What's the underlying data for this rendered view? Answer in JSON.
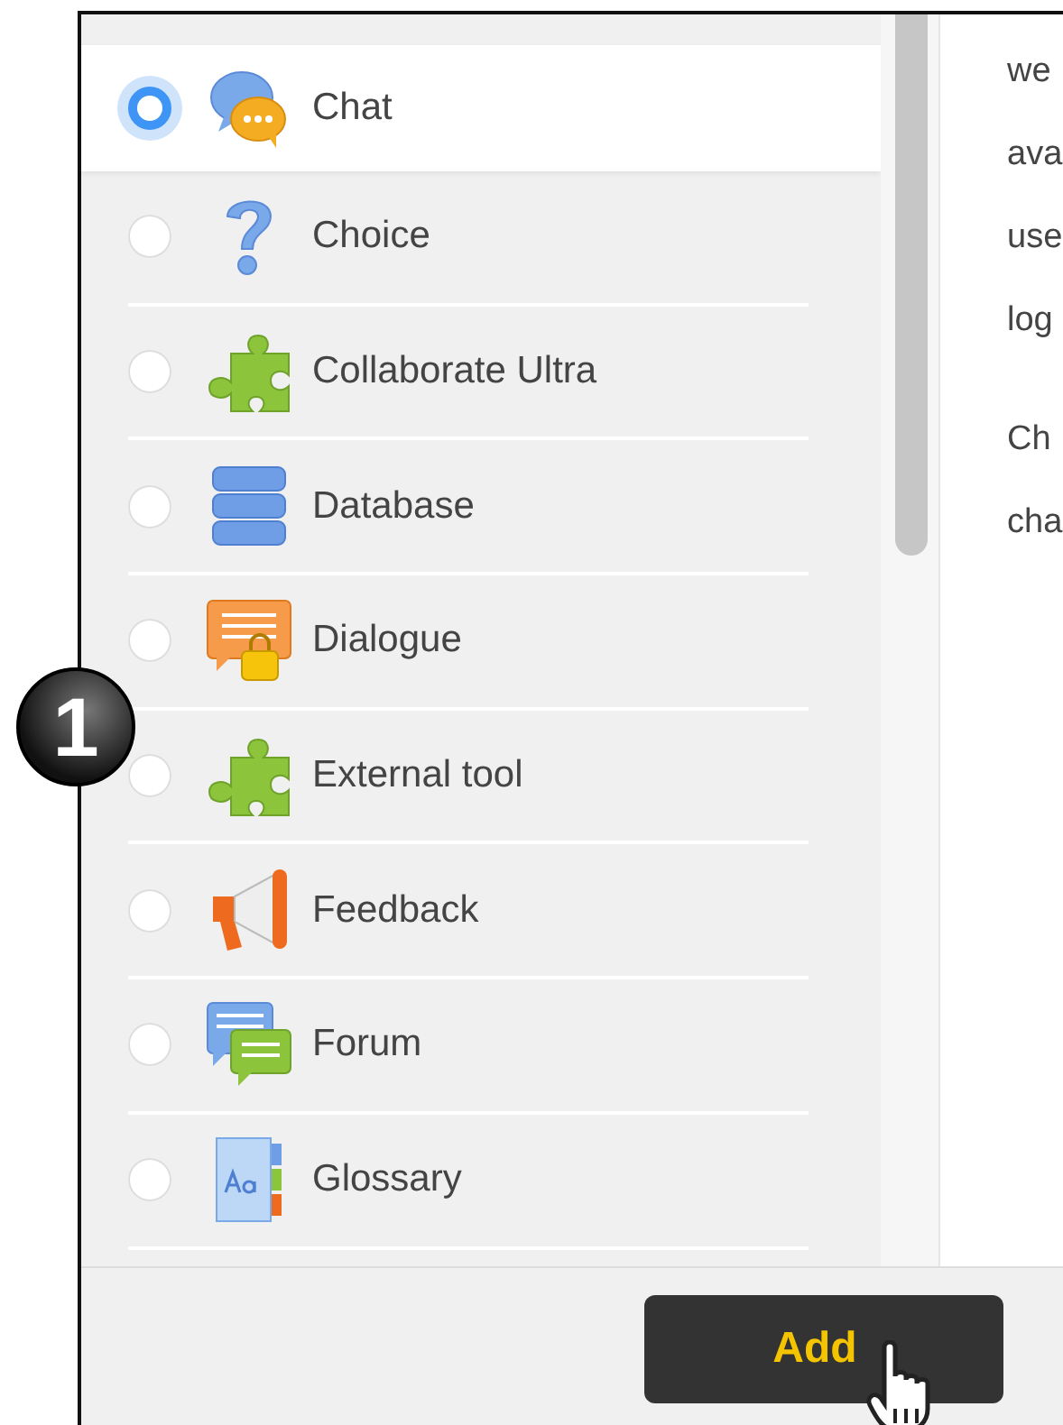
{
  "activities": [
    {
      "label": "Chat",
      "kind": "chat",
      "selected": true
    },
    {
      "label": "Choice",
      "kind": "question",
      "selected": false
    },
    {
      "label": "Collaborate Ultra",
      "kind": "puzzle",
      "selected": false
    },
    {
      "label": "Database",
      "kind": "database",
      "selected": false
    },
    {
      "label": "Dialogue",
      "kind": "dialogue",
      "selected": false
    },
    {
      "label": "External tool",
      "kind": "puzzle",
      "selected": false
    },
    {
      "label": "Feedback",
      "kind": "megaphone",
      "selected": false
    },
    {
      "label": "Forum",
      "kind": "forum",
      "selected": false
    },
    {
      "label": "Glossary",
      "kind": "glossary",
      "selected": false
    }
  ],
  "description": {
    "paragraphs": [
      [
        "we",
        "ava",
        "use",
        "log"
      ],
      [
        "Ch",
        "cha"
      ]
    ]
  },
  "callout_badge": "1",
  "add_button": "Add"
}
